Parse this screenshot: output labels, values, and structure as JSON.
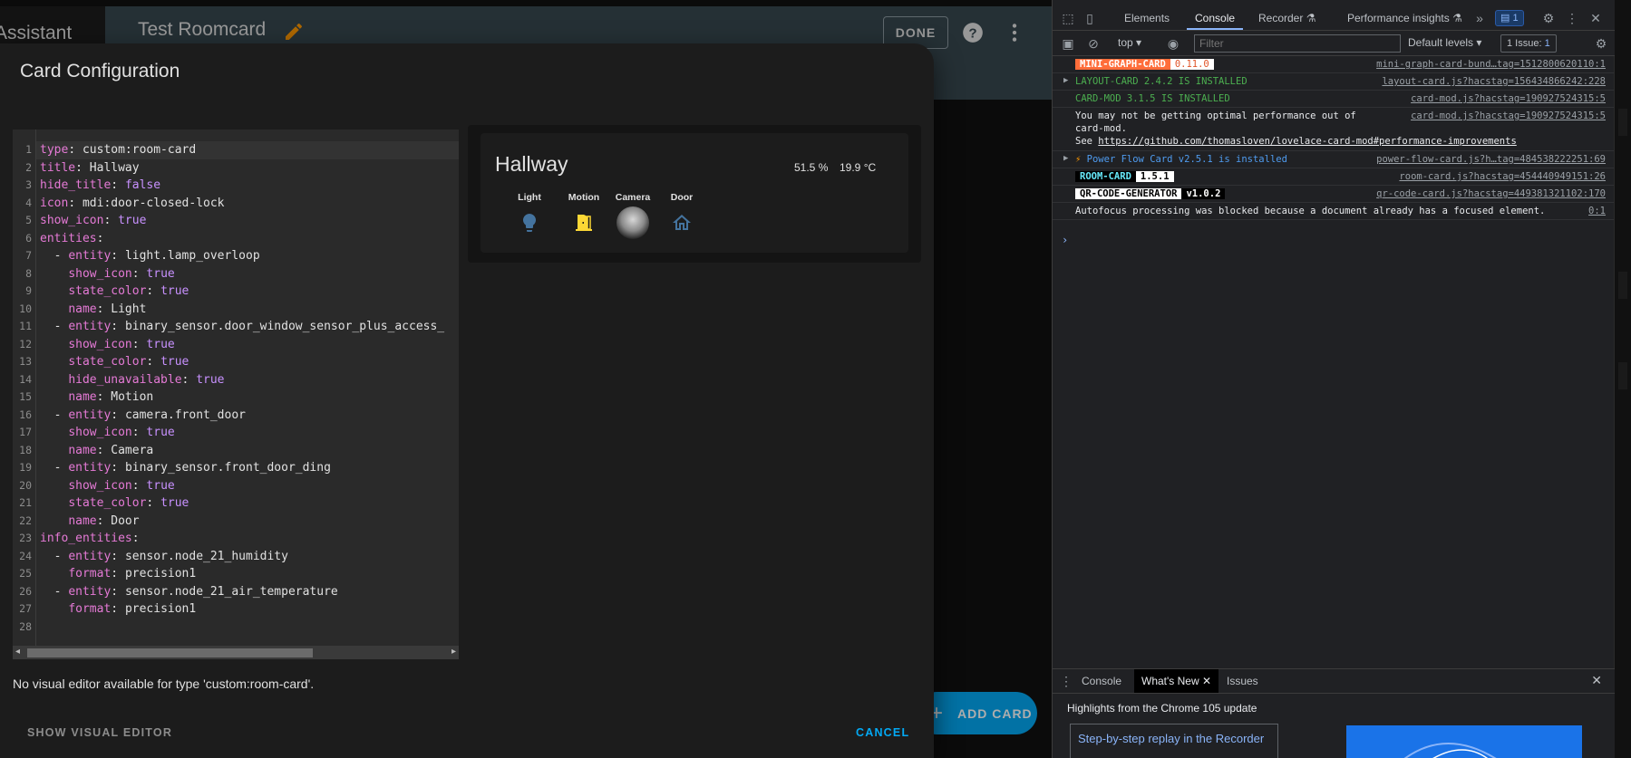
{
  "ha": {
    "sidebar_title": "Assistant",
    "dashboard_title": "Test Roomcard",
    "done_label": "DONE",
    "add_card_label": "ADD CARD"
  },
  "dialog": {
    "title": "Card Configuration",
    "no_visual_text": "No visual editor available for type 'custom:room-card'.",
    "show_visual_label": "SHOW VISUAL EDITOR",
    "cancel_label": "CANCEL",
    "yaml_lines": [
      {
        "k": "type",
        "v": "custom:room-card",
        "indent": ""
      },
      {
        "k": "title",
        "v": "Hallway",
        "indent": ""
      },
      {
        "k": "hide_title",
        "b": "false",
        "indent": ""
      },
      {
        "k": "icon",
        "v": "mdi:door-closed-lock",
        "indent": ""
      },
      {
        "k": "show_icon",
        "b": "true",
        "indent": ""
      },
      {
        "k": "entities",
        "indent": ""
      },
      {
        "k": "entity",
        "v": "light.lamp_overloop",
        "indent": "  - "
      },
      {
        "k": "show_icon",
        "b": "true",
        "indent": "    "
      },
      {
        "k": "state_color",
        "b": "true",
        "indent": "    "
      },
      {
        "k": "name",
        "v": "Light",
        "indent": "    "
      },
      {
        "k": "entity",
        "v": "binary_sensor.door_window_sensor_plus_access_",
        "indent": "  - "
      },
      {
        "k": "show_icon",
        "b": "true",
        "indent": "    "
      },
      {
        "k": "state_color",
        "b": "true",
        "indent": "    "
      },
      {
        "k": "hide_unavailable",
        "b": "true",
        "indent": "    "
      },
      {
        "k": "name",
        "v": "Motion",
        "indent": "    "
      },
      {
        "k": "entity",
        "v": "camera.front_door",
        "indent": "  - "
      },
      {
        "k": "show_icon",
        "b": "true",
        "indent": "    "
      },
      {
        "k": "name",
        "v": "Camera",
        "indent": "    "
      },
      {
        "k": "entity",
        "v": "binary_sensor.front_door_ding",
        "indent": "  - "
      },
      {
        "k": "show_icon",
        "b": "true",
        "indent": "    "
      },
      {
        "k": "state_color",
        "b": "true",
        "indent": "    "
      },
      {
        "k": "name",
        "v": "Door",
        "indent": "    "
      },
      {
        "k": "info_entities",
        "indent": ""
      },
      {
        "k": "entity",
        "v": "sensor.node_21_humidity",
        "indent": "  - "
      },
      {
        "k": "format",
        "v": "precision1",
        "indent": "    "
      },
      {
        "k": "entity",
        "v": "sensor.node_21_air_temperature",
        "indent": "  - "
      },
      {
        "k": "format",
        "v": "precision1",
        "indent": "    "
      }
    ],
    "line_numbers": [
      "1",
      "2",
      "3",
      "4",
      "5",
      "6",
      "7",
      "8",
      "9",
      "10",
      "11",
      "12",
      "13",
      "14",
      "15",
      "16",
      "17",
      "18",
      "19",
      "20",
      "21",
      "22",
      "23",
      "24",
      "25",
      "26",
      "27",
      "28"
    ]
  },
  "preview": {
    "room_title": "Hallway",
    "humidity": "51.5 %",
    "temperature": "19.9 °C",
    "entities": [
      {
        "name": "Light",
        "icon": "lightbulb-icon",
        "color": "#44739e"
      },
      {
        "name": "Motion",
        "icon": "door-open-icon",
        "color": "#fdd835"
      },
      {
        "name": "Camera",
        "icon": "camera-snapshot-icon",
        "color": "#cccccc"
      },
      {
        "name": "Door",
        "icon": "home-outline-icon",
        "color": "#44739e"
      }
    ]
  },
  "devtools": {
    "tabs": [
      "Elements",
      "Console",
      "Recorder",
      "Performance insights"
    ],
    "active_tab": "Console",
    "issues_badge": "1",
    "context": "top",
    "filter_placeholder": "Filter",
    "levels": "Default levels",
    "issue_count": "1 Issue:",
    "issue_count_badge": "1",
    "messages": [
      {
        "id": "mini-graph",
        "badge1": "MINI-GRAPH-CARD",
        "badge2": "0.11.0",
        "src": "mini-graph-card-bund…tag=1512800620110:1"
      },
      {
        "id": "layout-card",
        "text": "LAYOUT-CARD 2.4.2 IS INSTALLED",
        "src": "layout-card.js?hacstag=156434866242:228"
      },
      {
        "id": "card-mod",
        "text": "CARD-MOD 3.1.5 IS INSTALLED",
        "src": "card-mod.js?hacstag=190927524315:5"
      },
      {
        "id": "card-mod-perf",
        "text1": "You may not be getting optimal performance out of",
        "text2": "card-mod.",
        "text3_prefix": "See ",
        "link": "https://github.com/thomasloven/lovelace-card-mod#performance-improvements",
        "src": "card-mod.js?hacstag=190927524315:5"
      },
      {
        "id": "power-flow",
        "text": "Power Flow Card v2.5.1 is installed",
        "src": "power-flow-card.js?h…tag=484538222251:69"
      },
      {
        "id": "room-card",
        "badge1": "ROOM-CARD",
        "badge2": "1.5.1",
        "src": "room-card.js?hacstag=454440949151:26"
      },
      {
        "id": "qr-code",
        "badge1": "QR-CODE-GENERATOR",
        "badge2": "v1.0.2",
        "src": "qr-code-card.js?hacstag=449381321102:170"
      },
      {
        "id": "autofocus",
        "text": "Autofocus processing was blocked because a document already has a focused element.",
        "src": "0:1"
      }
    ],
    "drawer_tabs": [
      "Console",
      "What's New",
      "Issues"
    ],
    "drawer_active": "What's New",
    "highlights": "Highlights from the Chrome 105 update",
    "step_card": "Step-by-step replay in the Recorder"
  },
  "colors": {
    "ha_header": "#37474f",
    "accent": "#03a9f4",
    "dialog_bg": "#1c1c1c",
    "yaml_key": "#e57ad6",
    "yaml_bool": "#c891ff"
  }
}
